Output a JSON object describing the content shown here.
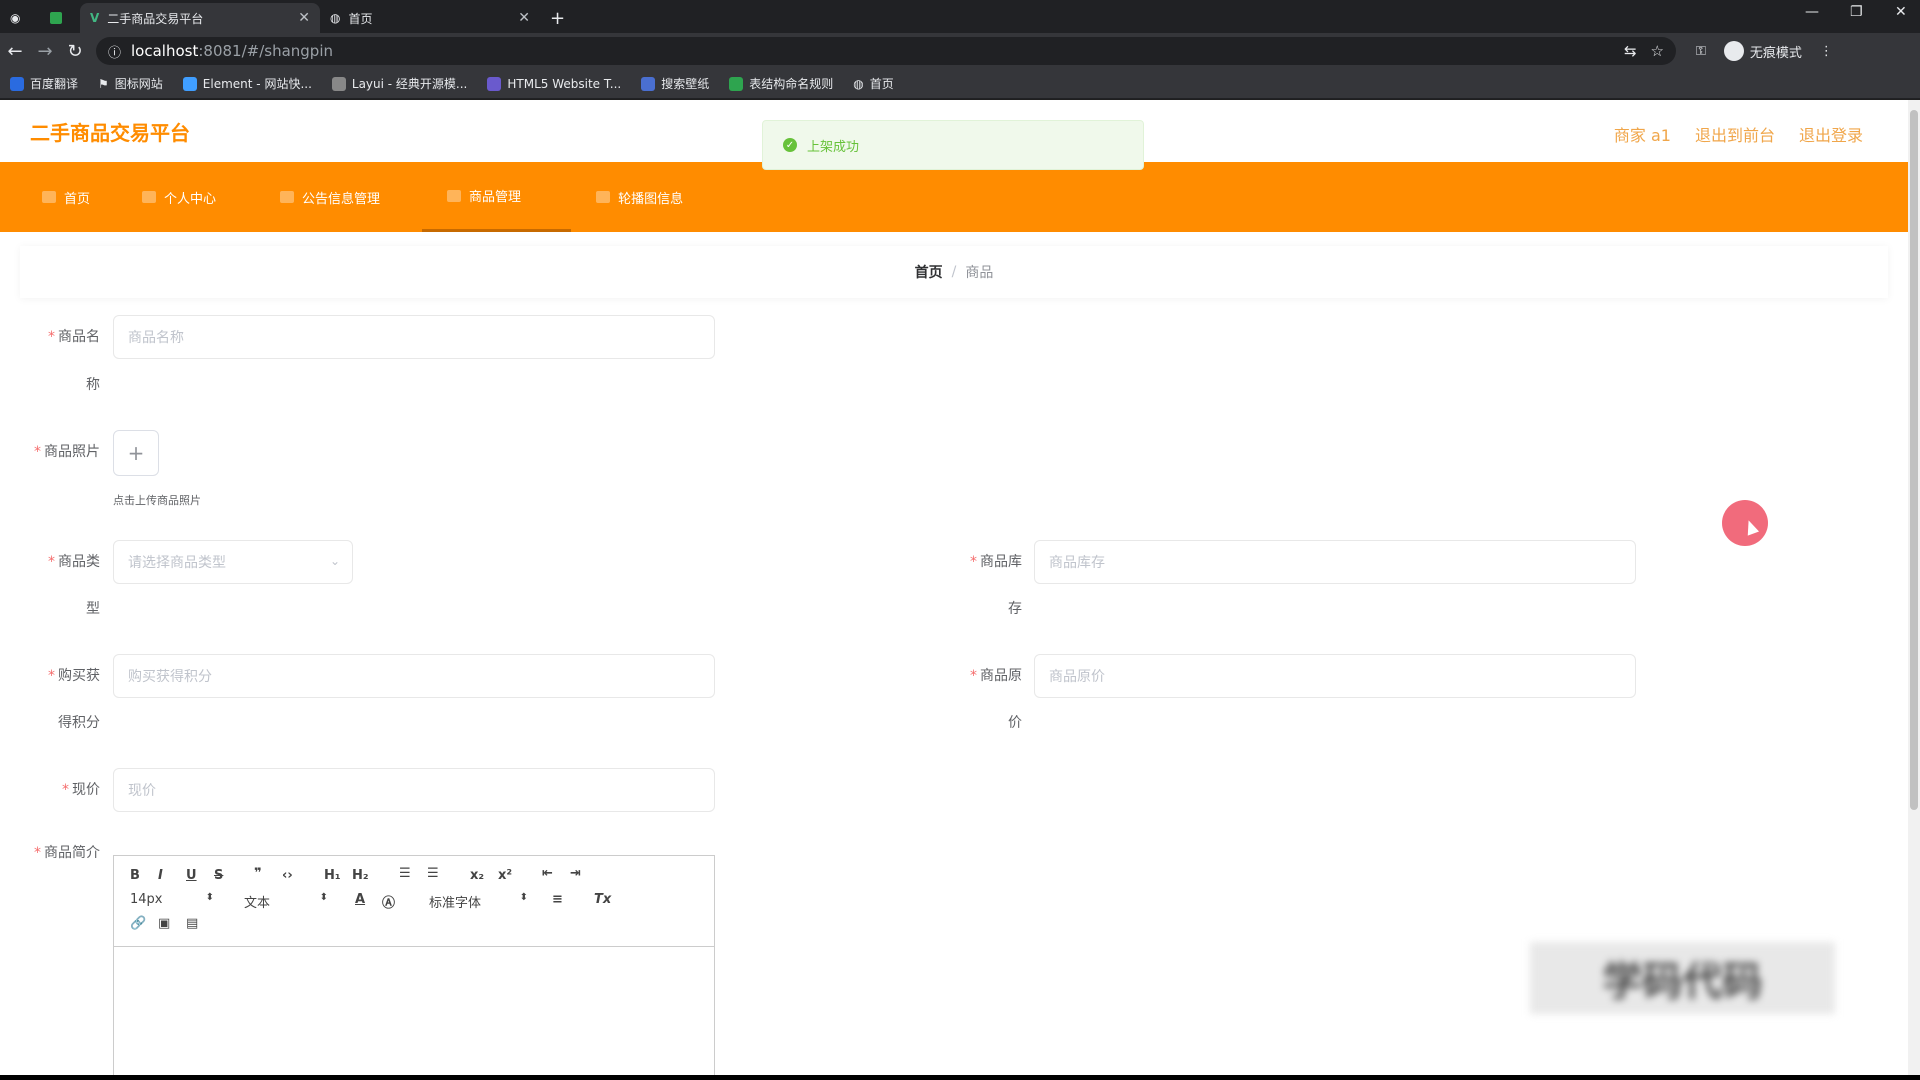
{
  "browser": {
    "tabs": [
      {
        "title": "二手商品交易平台",
        "active": true
      },
      {
        "title": "首页",
        "active": false
      }
    ],
    "url_host": "localhost",
    "url_path": ":8081/#/shangpin",
    "incognito_label": "无痕模式",
    "bookmarks": [
      {
        "label": "百度翻译",
        "color": "#2a6be0"
      },
      {
        "label": "图标网站",
        "color": "#ffffff"
      },
      {
        "label": "Element - 网站快...",
        "color": "#409eff"
      },
      {
        "label": "Layui - 经典开源模...",
        "color": "#888888"
      },
      {
        "label": "HTML5 Website T...",
        "color": "#6a5acd"
      },
      {
        "label": "搜索壁纸",
        "color": "#4a6fd0"
      },
      {
        "label": "表结构命名规则",
        "color": "#2ea44f"
      },
      {
        "label": "首页",
        "color": "#e8eaed"
      }
    ]
  },
  "header": {
    "logo": "二手商品交易平台",
    "user": "商家 a1",
    "back_front": "退出到前台",
    "logout": "退出登录"
  },
  "nav": [
    {
      "label": "首页",
      "active": false
    },
    {
      "label": "个人中心",
      "active": false
    },
    {
      "label": "公告信息管理",
      "active": false
    },
    {
      "label": "商品管理",
      "active": true
    },
    {
      "label": "轮播图信息",
      "active": false
    }
  ],
  "breadcrumb": {
    "home": "首页",
    "sep": "/",
    "current": "商品"
  },
  "toast": {
    "text": "上架成功"
  },
  "form": {
    "name": {
      "label1": "商品名",
      "label2": "称",
      "placeholder": "商品名称"
    },
    "photo": {
      "label": "商品照片",
      "tip": "点击上传商品照片"
    },
    "type": {
      "label1": "商品类",
      "label2": "型",
      "placeholder": "请选择商品类型"
    },
    "stock": {
      "label1": "商品库",
      "label2": "存",
      "placeholder": "商品库存"
    },
    "points": {
      "label1": "购买获",
      "label2": "得积分",
      "placeholder": "购买获得积分"
    },
    "orig_price": {
      "label1": "商品原",
      "label2": "价",
      "placeholder": "商品原价"
    },
    "price": {
      "label": "现价",
      "placeholder": "现价"
    },
    "intro": {
      "label": "商品简介"
    }
  },
  "editor": {
    "font_size": "14px",
    "text_type": "文本",
    "font_family": "标准字体"
  },
  "watermark": "学码代码"
}
